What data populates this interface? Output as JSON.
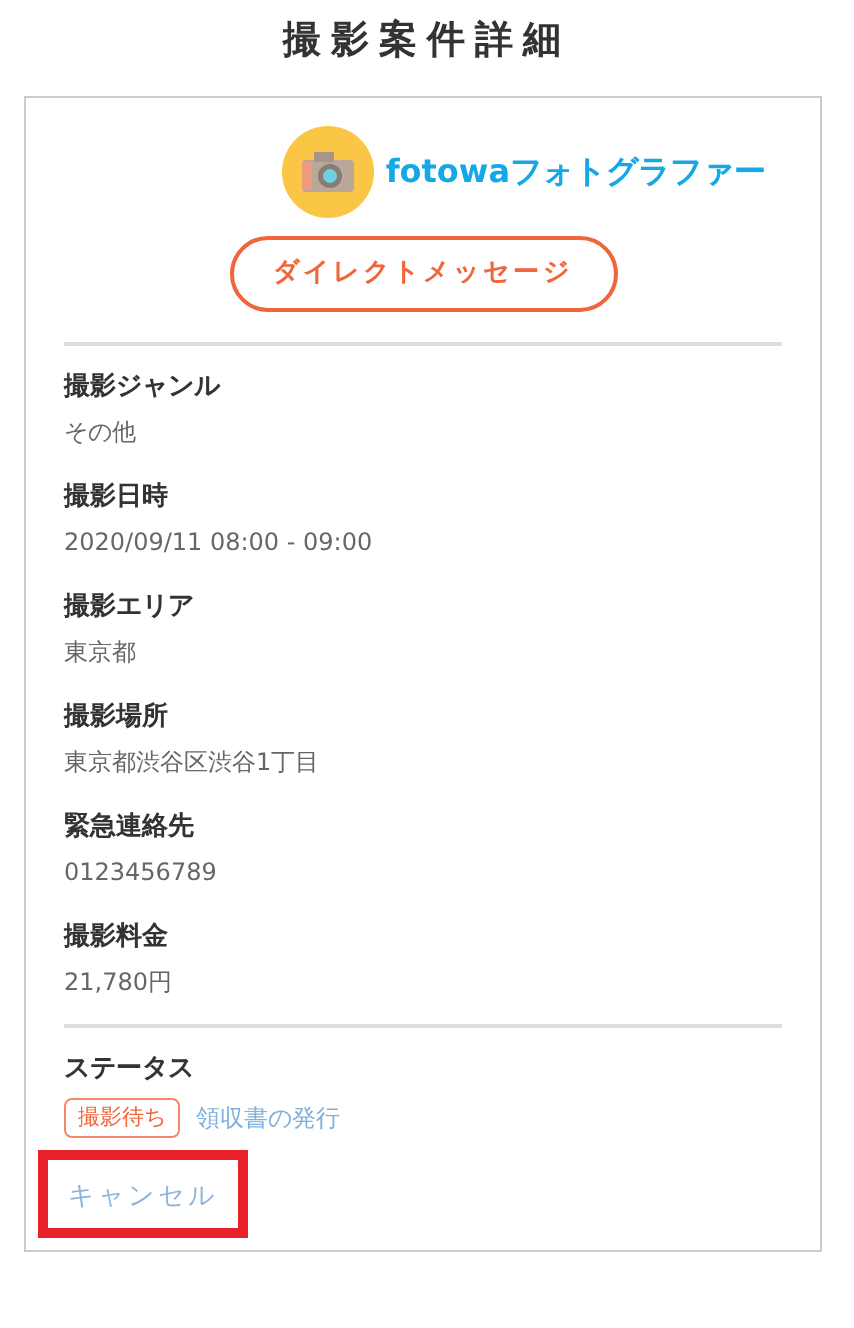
{
  "page_title": "撮影案件詳細",
  "brand": {
    "name": "fotowaフォトグラファー"
  },
  "message_button": "ダイレクトメッセージ",
  "fields": [
    {
      "label": "撮影ジャンル",
      "value": "その他"
    },
    {
      "label": "撮影日時",
      "value": "2020/09/11 08:00 - 09:00"
    },
    {
      "label": "撮影エリア",
      "value": "東京都"
    },
    {
      "label": "撮影場所",
      "value": "東京都渋谷区渋谷1丁目"
    },
    {
      "label": "緊急連絡先",
      "value": "0123456789"
    },
    {
      "label": "撮影料金",
      "value": "21,780円"
    }
  ],
  "status": {
    "label": "ステータス",
    "badge": "撮影待ち",
    "link": "領収書の発行"
  },
  "cancel": {
    "label": "キャンセル",
    "highlighted": true
  }
}
